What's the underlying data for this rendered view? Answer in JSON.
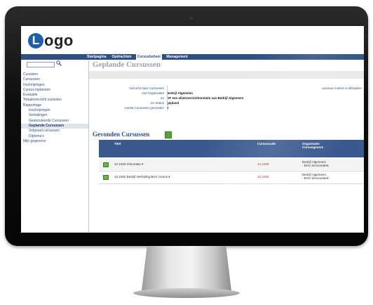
{
  "app": {
    "logo_letter": "L",
    "logo_text": "ogo",
    "brand_color": "#2e4f86"
  },
  "topnav": [
    {
      "label": "Startpagina"
    },
    {
      "label": "Opdrachten"
    },
    {
      "label": "Cursusbeheer",
      "active": true
    },
    {
      "label": "Management"
    }
  ],
  "search": {
    "value": "",
    "button_icon": "search-icon"
  },
  "sidebar": {
    "items": [
      {
        "label": "Cursisten"
      },
      {
        "label": "Cursussen"
      },
      {
        "label": "Inschrijvingen"
      },
      {
        "label": "Cursus inplannen"
      },
      {
        "label": "Evaluatie"
      },
      {
        "label": "Totaaloverzicht cursisten"
      },
      {
        "label": "Rapportage"
      },
      {
        "label": "Inschrijvingen",
        "sub": true
      },
      {
        "label": "Verhalingen",
        "sub": true
      },
      {
        "label": "Geannuleerde Cursussen",
        "sub": true
      },
      {
        "label": "Geplande Cursussen",
        "sub": true,
        "active": true
      },
      {
        "label": "Volgraad cursussen",
        "sub": true
      },
      {
        "label": "Diploma's",
        "sub": true
      },
      {
        "label": "Mijn gegevens"
      }
    ]
  },
  "page": {
    "title": "Geplande Cursussen"
  },
  "search_info": {
    "rows": [
      {
        "label": "Gezocht naar Cursussen",
        "value": ""
      },
      {
        "label": "met Organisatie",
        "value": "Bedrijf Algemeen"
      },
      {
        "label": "en",
        "value": "OF een afzetoverzichtsrelatie van Bedrijf Algemeen"
      },
      {
        "label": "en Status",
        "value": "gepland"
      },
      {
        "label": "Aantal Cursussen gevonden",
        "value": "2"
      }
    ],
    "right_link": "opnieuw zoeken ▾  afdrukken"
  },
  "results": {
    "title": "Gevonden Cursussen",
    "export_icon": "excel-icon",
    "columns": [
      "Titel",
      "Cursuscode",
      "Organisatie\nCursusgevers"
    ],
    "rows": [
      {
        "title": "12-1929 Informatie ▾",
        "code": "12-1929",
        "org": "Bedrijf Algemeen\n- BHV Servicedesk"
      },
      {
        "title": "12-1930 Bedrijf Herhaling BHV cursus ▾",
        "code": "12-1930",
        "org": "Bedrijf Algemeen\n- BHV Servicedesk"
      }
    ]
  }
}
